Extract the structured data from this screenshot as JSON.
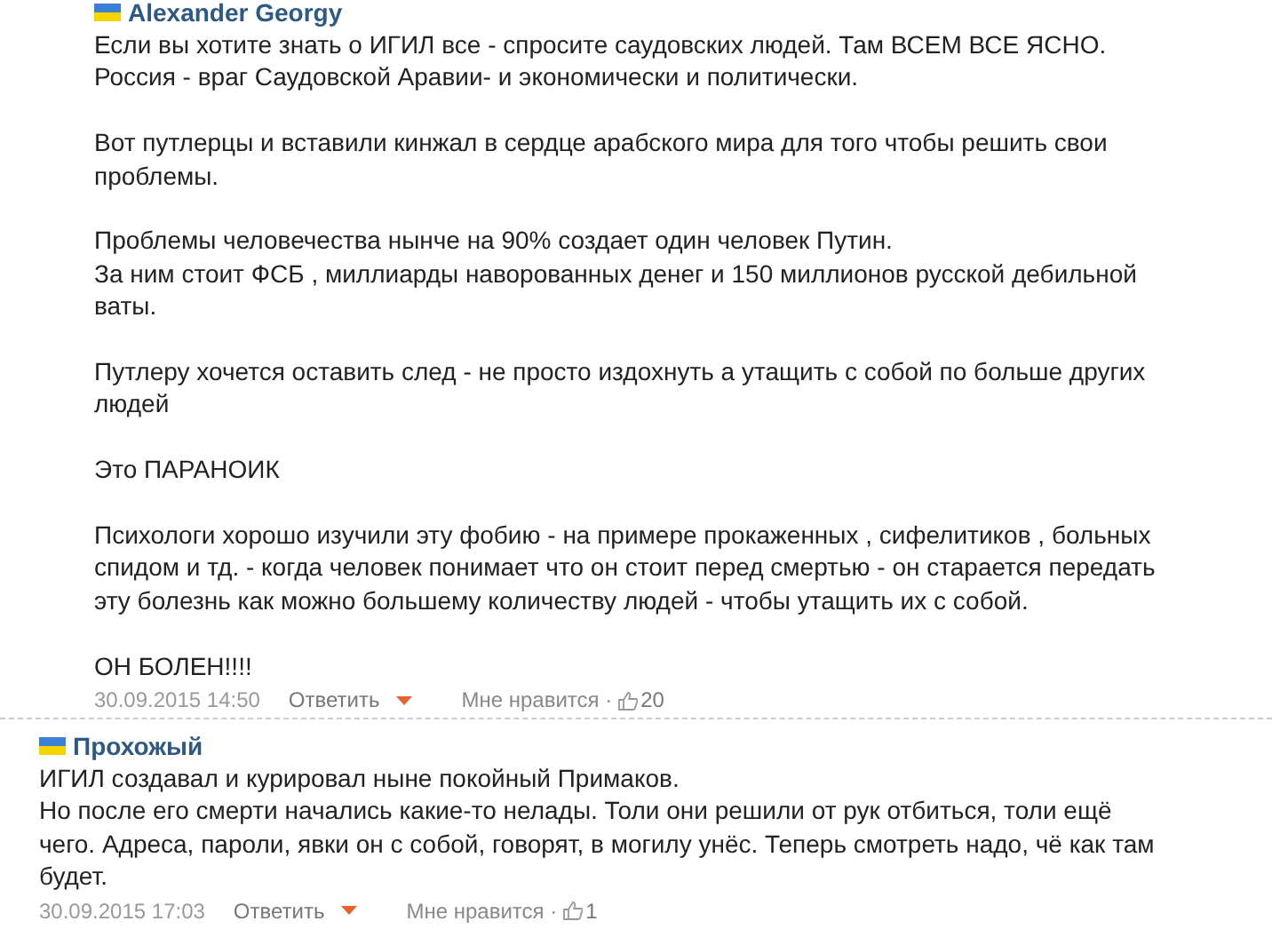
{
  "comments": [
    {
      "kind": "reply",
      "author": "Alexander Georgy",
      "paragraphs": [
        "Если вы хотите знать о ИГИЛ все - спросите саудовских людей. Там ВСЕМ ВСЕ ЯСНО.\nРоссия - враг Саудовской Аравии- и экономически и политически.",
        "Вот путлерцы и вставили кинжал в сердце арабского мира для того чтобы решить свои\nпроблемы.",
        "Проблемы человечества нынче на 90% создает один человек Путин.\nЗа ним стоит ФСБ , миллиарды наворованных денег и 150 миллионов русской дебильной\nваты.",
        "Путлеру хочется оставить след - не просто издохнуть а утащить с собой по больше других\nлюдей",
        "Это ПАРАНОИК",
        "Психологи хорошо изучили эту фобию - на примере прокаженных , сифелитиков , больных\nспидом и тд. - когда человек понимает что он стоит перед смертью - он старается передать\nэту болезнь как можно большему количеству людей - чтобы утащить их с собой.",
        "ОН БОЛЕН!!!!"
      ],
      "date": "30.09.2015 14:50",
      "reply": "Ответить",
      "like": "Мне нравится ·",
      "likes": "20"
    },
    {
      "kind": "comment",
      "author": "Прохожый",
      "paragraphs": [
        "ИГИЛ создавал и курировал ныне покойный Примаков.\nНо после его смерти начались какие-то нелады. Толи они решили от рук отбиться, толи ещё\nчего. Адреса, пароли, явки он с собой, говорят, в могилу унёс. Теперь смотреть надо, чё как там\nбудет."
      ],
      "date": "30.09.2015 17:03",
      "reply": "Ответить",
      "like": "Мне нравится ·",
      "likes": "1"
    }
  ]
}
